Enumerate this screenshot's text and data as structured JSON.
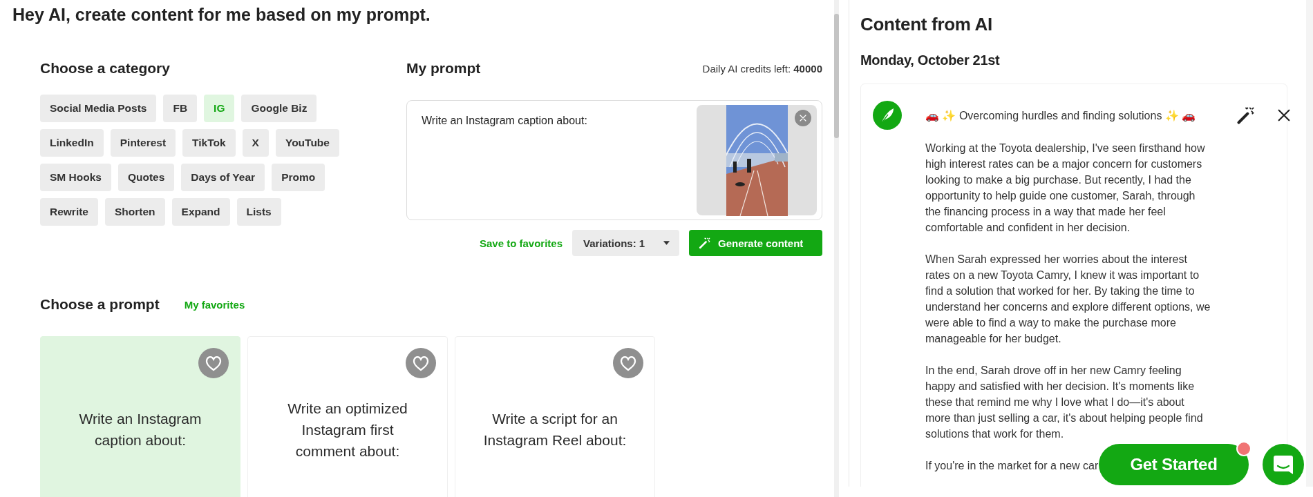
{
  "heading": "Hey AI, create content for me based on my prompt.",
  "category_section": {
    "title": "Choose a category",
    "categories": [
      {
        "label": "Social Media Posts",
        "selected": false
      },
      {
        "label": "FB",
        "selected": false
      },
      {
        "label": "IG",
        "selected": true
      },
      {
        "label": "Google Biz",
        "selected": false
      },
      {
        "label": "LinkedIn",
        "selected": false
      },
      {
        "label": "Pinterest",
        "selected": false
      },
      {
        "label": "TikTok",
        "selected": false
      },
      {
        "label": "X",
        "selected": false
      },
      {
        "label": "YouTube",
        "selected": false
      },
      {
        "label": "SM Hooks",
        "selected": false
      },
      {
        "label": "Quotes",
        "selected": false
      },
      {
        "label": "Days of Year",
        "selected": false
      },
      {
        "label": "Promo",
        "selected": false
      },
      {
        "label": "Rewrite",
        "selected": false
      },
      {
        "label": "Shorten",
        "selected": false
      },
      {
        "label": "Expand",
        "selected": false
      },
      {
        "label": "Lists",
        "selected": false
      }
    ]
  },
  "prompt_section": {
    "title": "My prompt",
    "credits": "Daily AI credits left: **40000**",
    "prompt_text": "Write an Instagram caption about:",
    "save_link": "Save to favorites",
    "variations": "Variations: 1",
    "generate_button": "Generate content"
  },
  "prompts_section": {
    "title": "Choose a prompt",
    "favorites_link": "My favorites",
    "cards": [
      {
        "text": "Write an Instagram caption about:",
        "selected": true
      },
      {
        "text": "Write an optimized Instagram first comment about:",
        "selected": false
      },
      {
        "text": "Write a script for an Instagram Reel about:",
        "selected": false
      }
    ]
  },
  "output": {
    "title": "Content from AI",
    "date": "Monday, October 21st",
    "result": {
      "title": "🚗 ✨ Overcoming hurdles and finding solutions ✨ 🚗",
      "paragraphs": [
        "Working at the Toyota dealership, I've seen firsthand how high interest rates can be a major concern for customers looking to make a big purchase. But recently, I had the opportunity to help guide one customer, Sarah, through the financing process in a way that made her feel comfortable and confident in her decision.",
        "When Sarah expressed her worries about the interest rates on a new Toyota Camry, I knew it was important to find a solution that worked for her. By taking the time to understand her concerns and explore different options, we were able to find a way to make the purchase more manageable for her budget.",
        "In the end, Sarah drove off in her new Camry feeling happy and satisfied with her decision. It's moments like these that remind me why I love what I do—it's about more than just selling a car, it's about helping people find solutions that work for them.",
        "If you're in the market for a new car"
      ]
    }
  },
  "get_started_button": "Get Started"
}
